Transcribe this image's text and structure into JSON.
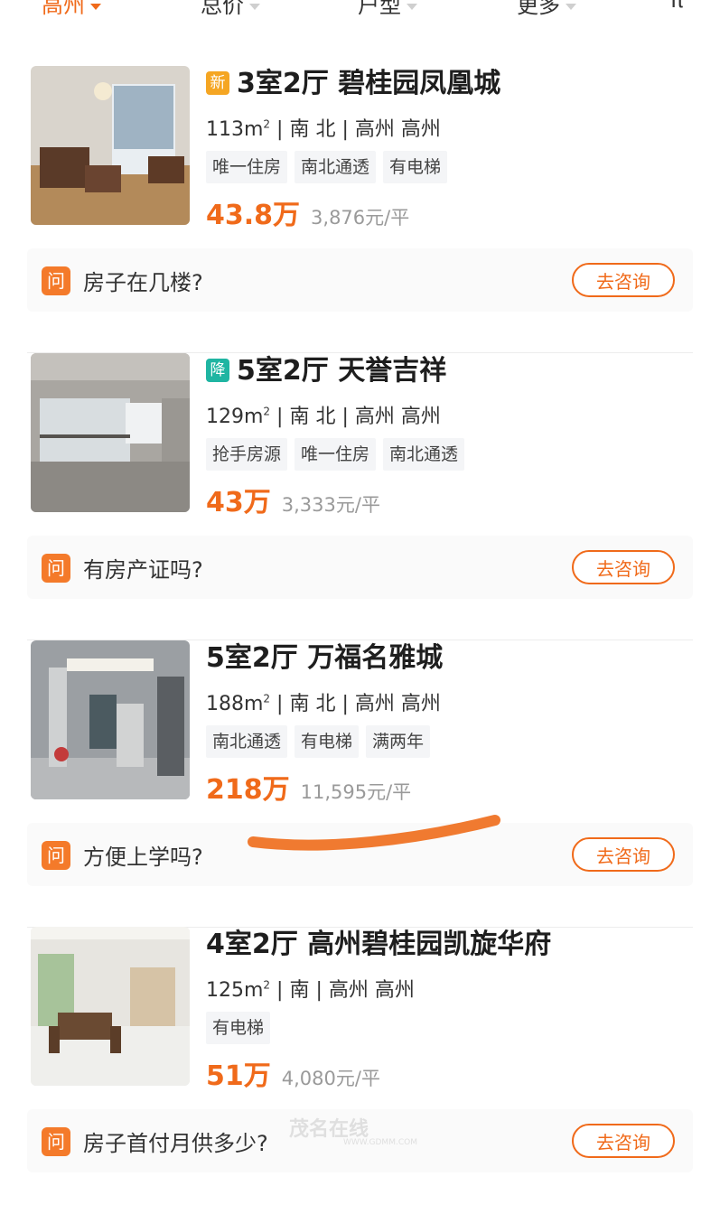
{
  "filters": [
    {
      "label": "高州",
      "active": true
    },
    {
      "label": "总价",
      "active": false
    },
    {
      "label": "户型",
      "active": false
    },
    {
      "label": "更多",
      "active": false
    },
    {
      "label": "π",
      "active": false
    }
  ],
  "listings": [
    {
      "badge": "新",
      "title": "3室2厅 碧桂园凤凰城",
      "area": "113m",
      "area_sup": "2",
      "meta_rest": " | 南 北 | 高州 高州",
      "tags": [
        "唯一住房",
        "南北通透",
        "有电梯"
      ],
      "price": "43.8万",
      "unit_price": "3,876元/平",
      "question_icon": "问",
      "question": "房子在几楼?",
      "consult_label": "去咨询"
    },
    {
      "badge": "降",
      "title": "5室2厅 天誉吉祥",
      "area": "129m",
      "area_sup": "2",
      "meta_rest": " | 南 北 | 高州 高州",
      "tags": [
        "抢手房源",
        "唯一住房",
        "南北通透"
      ],
      "price": "43万",
      "unit_price": "3,333元/平",
      "question_icon": "问",
      "question": "有房产证吗?",
      "consult_label": "去咨询"
    },
    {
      "badge": "",
      "title": "5室2厅 万福名雅城",
      "area": "188m",
      "area_sup": "2",
      "meta_rest": " | 南 北 | 高州 高州",
      "tags": [
        "南北通透",
        "有电梯",
        "满两年"
      ],
      "price": "218万",
      "unit_price": "11,595元/平",
      "question_icon": "问",
      "question": "方便上学吗?",
      "consult_label": "去咨询"
    },
    {
      "badge": "",
      "title": "4室2厅 高州碧桂园凯旋华府",
      "area": "125m",
      "area_sup": "2",
      "meta_rest": " | 南 | 高州 高州",
      "tags": [
        "有电梯"
      ],
      "price": "51万",
      "unit_price": "4,080元/平",
      "question_icon": "问",
      "question": "房子首付月供多少?",
      "consult_label": "去咨询"
    }
  ],
  "watermark": {
    "brand": "茂名在线",
    "url": "WWW.GDMM.COM"
  },
  "colors": {
    "accent": "#f06a1a",
    "badge_new": "#f5a623",
    "badge_down": "#1fb5a2",
    "annotation_stroke": "#f07a30"
  }
}
